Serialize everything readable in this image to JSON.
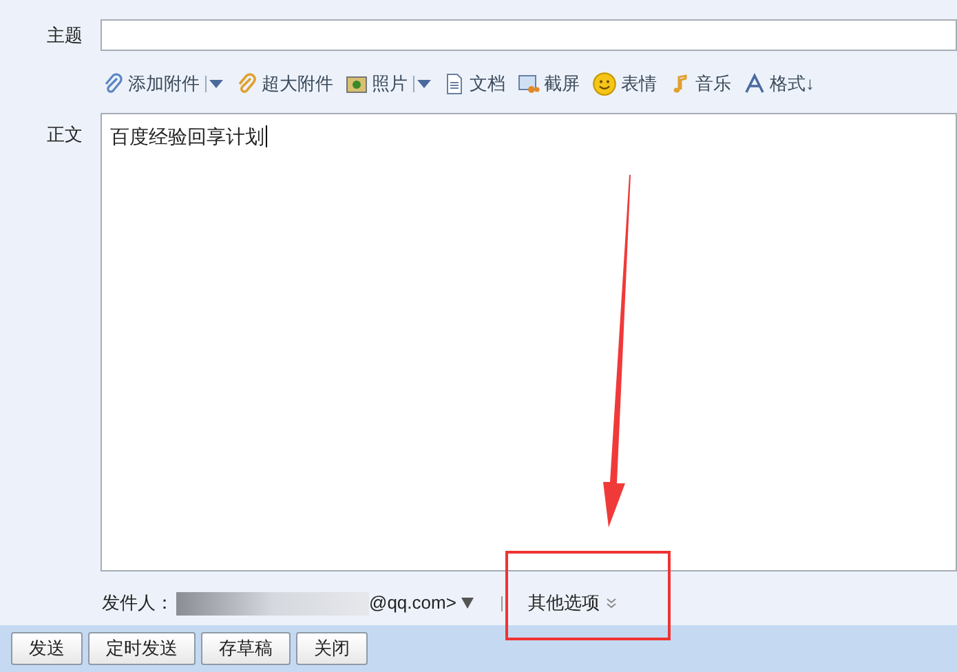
{
  "subject": {
    "label": "主题"
  },
  "toolbar": [
    {
      "kind": "attach",
      "label": "添加附件",
      "dropdown": true
    },
    {
      "kind": "bigattach",
      "label": "超大附件",
      "dropdown": false
    },
    {
      "kind": "photo",
      "label": "照片",
      "dropdown": true
    },
    {
      "kind": "doc",
      "label": "文档",
      "dropdown": false
    },
    {
      "kind": "screenshot",
      "label": "截屏",
      "dropdown": false
    },
    {
      "kind": "emoji",
      "label": "表情",
      "dropdown": false
    },
    {
      "kind": "music",
      "label": "音乐",
      "dropdown": false
    },
    {
      "kind": "format",
      "label": "格式↓",
      "dropdown": false
    }
  ],
  "body": {
    "label": "正文",
    "value": "百度经验回享计划"
  },
  "sender": {
    "label": "发件人：",
    "address": "@qq.com>",
    "more": "其他选项"
  },
  "buttons": [
    "发送",
    "定时发送",
    "存草稿",
    "关闭"
  ]
}
